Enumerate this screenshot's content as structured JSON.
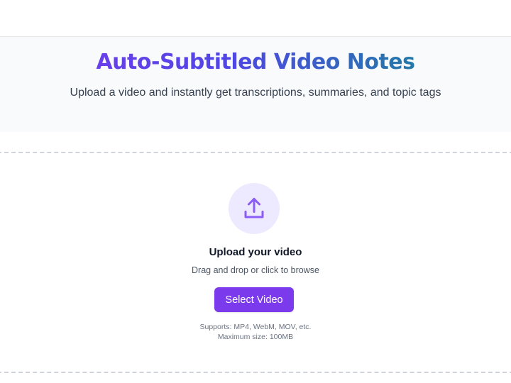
{
  "hero": {
    "title_part1": "Auto-Subtitled Video ",
    "title_part2": "Notes",
    "subtitle": "Upload a video and instantly get transcriptions, summaries, and topic tags"
  },
  "upload": {
    "icon": "upload-icon",
    "title": "Upload your video",
    "hint": "Drag and drop or click to browse",
    "button_label": "Select Video",
    "supports": "Supports: MP4, WebM, MOV, etc.",
    "max_size": "Maximum size: 100MB"
  },
  "colors": {
    "accent": "#7c3aed",
    "accent_light": "#ede9fe",
    "title_gradient_end": "#0d9488"
  }
}
